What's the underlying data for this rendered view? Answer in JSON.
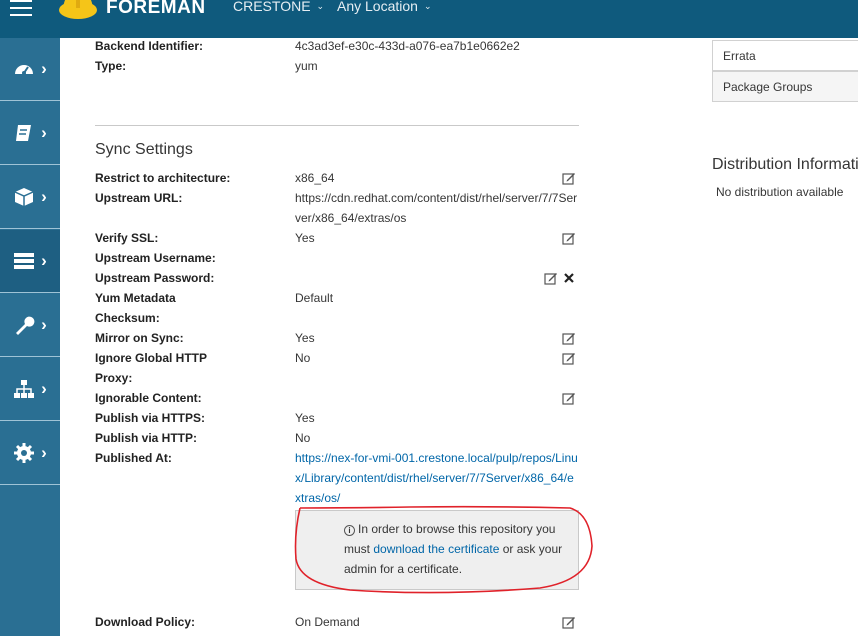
{
  "header": {
    "brand": "FOREMAN",
    "organization": "CRESTONE",
    "location": "Any Location"
  },
  "nav": {
    "items": [
      "monitor",
      "content",
      "hosts",
      "configure",
      "infrastructure",
      "networks",
      "administer"
    ],
    "active": "configure",
    "bg_color": "#2a6f93",
    "top_color": "#0f5a7d"
  },
  "details": {
    "backend_identifier_label": "Backend Identifier:",
    "backend_identifier_value": "4c3ad3ef-e30c-433d-a076-ea7b1e0662e2",
    "type_label": "Type:",
    "type_value": "yum"
  },
  "sync_settings": {
    "title": "Sync Settings",
    "rows": [
      {
        "label": "Restrict to architecture:",
        "value": "x86_64"
      },
      {
        "label": "Upstream URL:",
        "value": "https://cdn.redhat.com/content/dist/rhel/server/7/7Server/x86_64/extras/os"
      },
      {
        "label": "Verify SSL:",
        "value": "Yes"
      },
      {
        "label": "Upstream Username:",
        "value": ""
      },
      {
        "label": "Upstream Password:",
        "value": ""
      },
      {
        "label": "Yum Metadata Checksum:",
        "value": "Default"
      },
      {
        "label": "Mirror on Sync:",
        "value": "Yes"
      },
      {
        "label": "Ignore Global HTTP Proxy:",
        "value": "No"
      },
      {
        "label": "Ignorable Content:",
        "value": ""
      },
      {
        "label": "Publish via HTTPS:",
        "value": "Yes"
      },
      {
        "label": "Publish via HTTP:",
        "value": "No"
      },
      {
        "label": "Published At:",
        "value": "https://nex-for-vmi-001.crestone.local/pulp/repos/Linux/Library/content/dist/rhel/server/7/7Server/x86_64/extras/os/"
      },
      {
        "label": "Download Policy:",
        "value": "On Demand"
      }
    ]
  },
  "certificate_notice": {
    "text_before": "In order to browse this repository you must ",
    "link": "download the certificate",
    "text_after": " or ask your admin for a certificate."
  },
  "right_panel": {
    "table_rows": [
      "Errata",
      "Package Groups"
    ],
    "distribution_title": "Distribution Information",
    "distribution_text": "No distribution available"
  }
}
